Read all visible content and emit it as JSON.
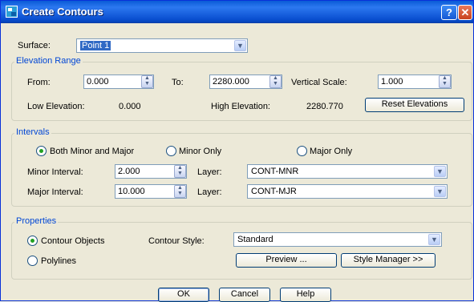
{
  "window": {
    "title": "Create Contours",
    "help_symbol": "?",
    "close_symbol": "✕"
  },
  "surface": {
    "label": "Surface:",
    "value": "Point 1"
  },
  "elevation_range": {
    "title": "Elevation Range",
    "from_label": "From:",
    "from_value": "0.000",
    "to_label": "To:",
    "to_value": "2280.000",
    "vscale_label": "Vertical Scale:",
    "vscale_value": "1.000",
    "low_label": "Low Elevation:",
    "low_value": "0.000",
    "high_label": "High Elevation:",
    "high_value": "2280.770",
    "reset_label": "Reset Elevations"
  },
  "intervals": {
    "title": "Intervals",
    "opt_both": "Both Minor and Major",
    "opt_minor": "Minor Only",
    "opt_major": "Major Only",
    "selected": "both",
    "minor_label": "Minor Interval:",
    "minor_value": "2.000",
    "major_label": "Major Interval:",
    "major_value": "10.000",
    "layer_label": "Layer:",
    "minor_layer": "CONT-MNR",
    "major_layer": "CONT-MJR"
  },
  "properties": {
    "title": "Properties",
    "opt_contour": "Contour Objects",
    "opt_polylines": "Polylines",
    "selected": "contour",
    "style_label": "Contour Style:",
    "style_value": "Standard",
    "preview_label": "Preview ...",
    "style_manager_label": "Style Manager >>"
  },
  "footer": {
    "ok": "OK",
    "cancel": "Cancel",
    "help": "Help"
  }
}
